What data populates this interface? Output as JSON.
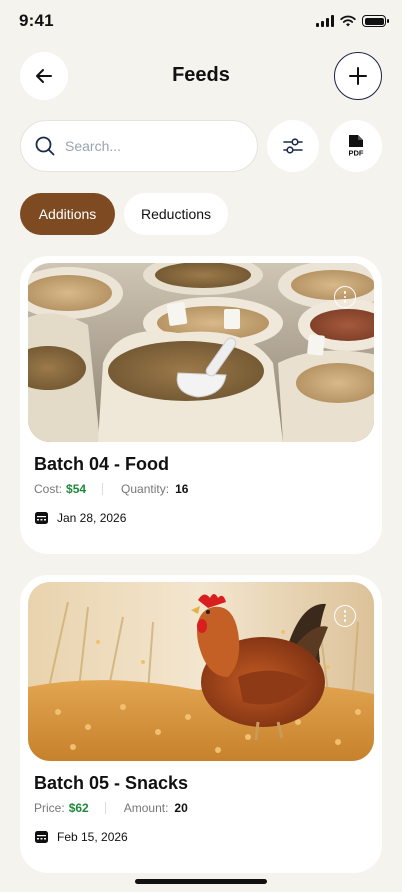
{
  "status_bar": {
    "time": "9:41"
  },
  "header": {
    "title": "Feeds",
    "back_icon": "arrow-left-icon",
    "add_icon": "plus-icon"
  },
  "search": {
    "placeholder": "Search...",
    "value": ""
  },
  "toolbar": {
    "filter_icon": "sliders-icon",
    "pdf_icon": "pdf-file-icon",
    "pdf_label": "PDF"
  },
  "tabs": [
    {
      "label": "Additions",
      "active": true
    },
    {
      "label": "Reductions",
      "active": false
    }
  ],
  "cards": [
    {
      "title": "Batch 04 - Food",
      "field1_label": "Cost:",
      "field1_value": "$54",
      "field2_label": "Quantity:",
      "field2_value": "16",
      "date": "Jan 28, 2026",
      "image": "feed-sacks-photo"
    },
    {
      "title": "Batch 05 - Snacks",
      "field1_label": "Price:",
      "field1_value": "$62",
      "field2_label": "Amount:",
      "field2_value": "20",
      "date": "Feb 15, 2026",
      "image": "hen-eating-grain-photo"
    }
  ],
  "colors": {
    "accent": "#7e4a22",
    "value_green": "#1f8a3b",
    "background": "#f5f3ee"
  }
}
